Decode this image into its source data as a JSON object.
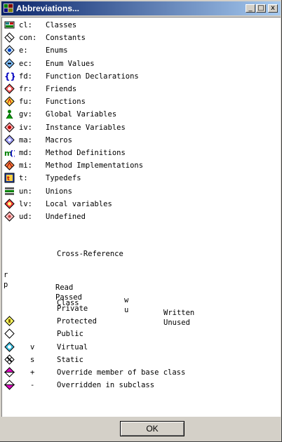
{
  "window": {
    "title": "Abbreviations..."
  },
  "window_buttons": {
    "minimize": "_",
    "maximize": "□",
    "close": "x"
  },
  "abbreviations": [
    {
      "abbr": "cl:",
      "desc": "Classes",
      "icon": "class-icon"
    },
    {
      "abbr": "con:",
      "desc": "Constants",
      "icon": "constant-icon"
    },
    {
      "abbr": "e:",
      "desc": "Enums",
      "icon": "enum-icon"
    },
    {
      "abbr": "ec:",
      "desc": "Enum Values",
      "icon": "enum-value-icon"
    },
    {
      "abbr": "fd:",
      "desc": "Function Declarations",
      "icon": "function-declaration-icon"
    },
    {
      "abbr": "fr:",
      "desc": "Friends",
      "icon": "friend-icon"
    },
    {
      "abbr": "fu:",
      "desc": "Functions",
      "icon": "function-icon"
    },
    {
      "abbr": "gv:",
      "desc": "Global Variables",
      "icon": "global-variable-icon"
    },
    {
      "abbr": "iv:",
      "desc": "Instance Variables",
      "icon": "instance-variable-icon"
    },
    {
      "abbr": "ma:",
      "desc": "Macros",
      "icon": "macro-icon"
    },
    {
      "abbr": "md:",
      "desc": "Method Definitions",
      "icon": "method-definition-icon"
    },
    {
      "abbr": "mi:",
      "desc": "Method Implementations",
      "icon": "method-implementation-icon"
    },
    {
      "abbr": "t:",
      "desc": "Typedefs",
      "icon": "typedef-icon"
    },
    {
      "abbr": "un:",
      "desc": "Unions",
      "icon": "union-icon"
    },
    {
      "abbr": "lv:",
      "desc": "Local variables",
      "icon": "local-variable-icon"
    },
    {
      "abbr": "ud:",
      "desc": "Undefined",
      "icon": "undefined-icon"
    }
  ],
  "cross_reference": {
    "heading": "Cross-Reference",
    "rows": [
      {
        "k1": "r",
        "v1": "Read",
        "k2": "w",
        "v2": "Written"
      },
      {
        "k1": "p",
        "v1": "Passed",
        "k2": "u",
        "v2": "Unused"
      }
    ]
  },
  "class_section": {
    "heading": "Class",
    "items": [
      {
        "sym": "",
        "desc": "Private",
        "icon": ""
      },
      {
        "sym": "",
        "desc": "Protected",
        "icon": "protected-icon"
      },
      {
        "sym": "",
        "desc": "Public",
        "icon": "public-icon"
      },
      {
        "sym": "v",
        "desc": "Virtual",
        "icon": "virtual-icon"
      },
      {
        "sym": "s",
        "desc": "Static",
        "icon": "static-icon"
      },
      {
        "sym": "+",
        "desc": "Override member of base class",
        "icon": "override-icon"
      },
      {
        "sym": "-",
        "desc": "Overridden in subclass",
        "icon": "overridden-icon"
      }
    ]
  },
  "footer": {
    "ok_label": "OK"
  }
}
